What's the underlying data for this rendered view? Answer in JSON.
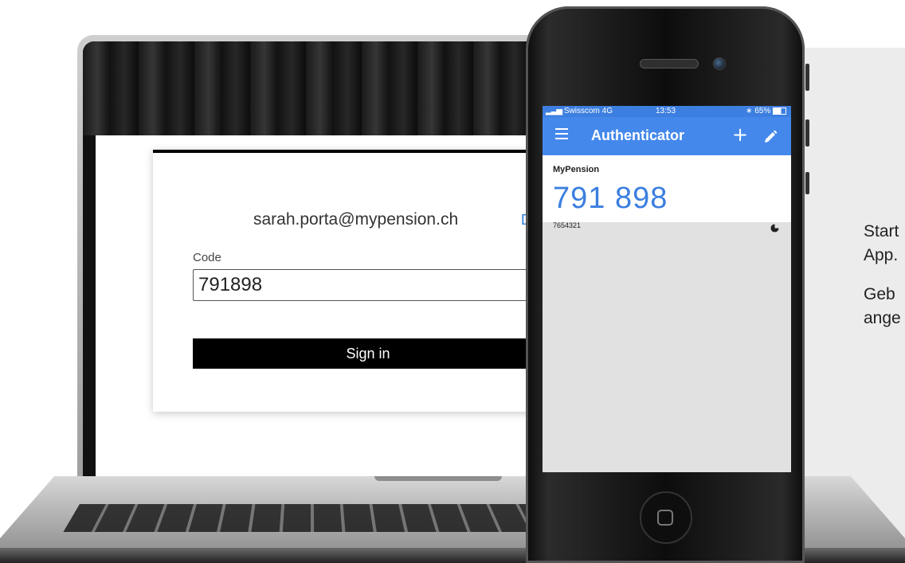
{
  "laptop": {
    "email": "sarah.porta@mypension.ch",
    "back_link": "D",
    "code_label": "Code",
    "code_value": "791898",
    "signin_label": "Sign in"
  },
  "phone": {
    "carrier": "Swisscom 4G",
    "time": "13:53",
    "battery": "65%",
    "app_title": "Authenticator",
    "menu_icon": "hamburger-menu-icon",
    "add_icon": "plus-icon",
    "edit_icon": "pencil-icon",
    "entry": {
      "name": "MyPension",
      "code": "791 898",
      "account": "7654321",
      "timer_icon": "countdown-timer-icon"
    }
  },
  "side_text": {
    "line1": "Start",
    "line2": "App.",
    "line3": "Geb",
    "line4": "ange"
  },
  "colors": {
    "accent_blue": "#4488ec",
    "status_blue": "#3d7fe0",
    "code_blue": "#3b7fe0",
    "button_black": "#000000"
  }
}
